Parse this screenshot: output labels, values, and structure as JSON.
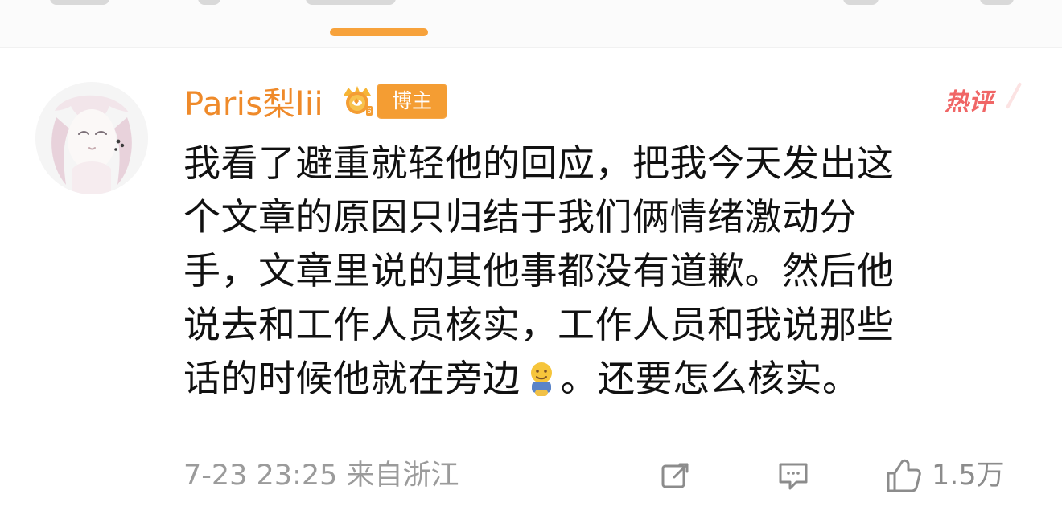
{
  "comment": {
    "username": "Paris梨lii",
    "badge_label": "博主",
    "hot_label": "热评",
    "text_lines": [
      "我看了避重就轻他的回应，把我今天发出这",
      "个文章的原因只归结于我们俩情绪激动分",
      "手，文章里说的其他事都没有道歉。然后他",
      "说去和工作人员核实，工作人员和我说那些",
      "话的时候他就在旁边",
      "。还要怎么核实。"
    ],
    "timestamp": "7-23 23:25  来自浙江",
    "actions": {
      "share_icon": "share-icon",
      "reply_icon": "reply-icon",
      "like_icon": "like-icon",
      "like_count": "1.5万"
    }
  },
  "colors": {
    "accent": "#f7a23b",
    "username": "#ef8a2a",
    "badge": "#f49d33",
    "hot": "#f06666",
    "text": "#111111",
    "muted": "#9b9b9b"
  }
}
